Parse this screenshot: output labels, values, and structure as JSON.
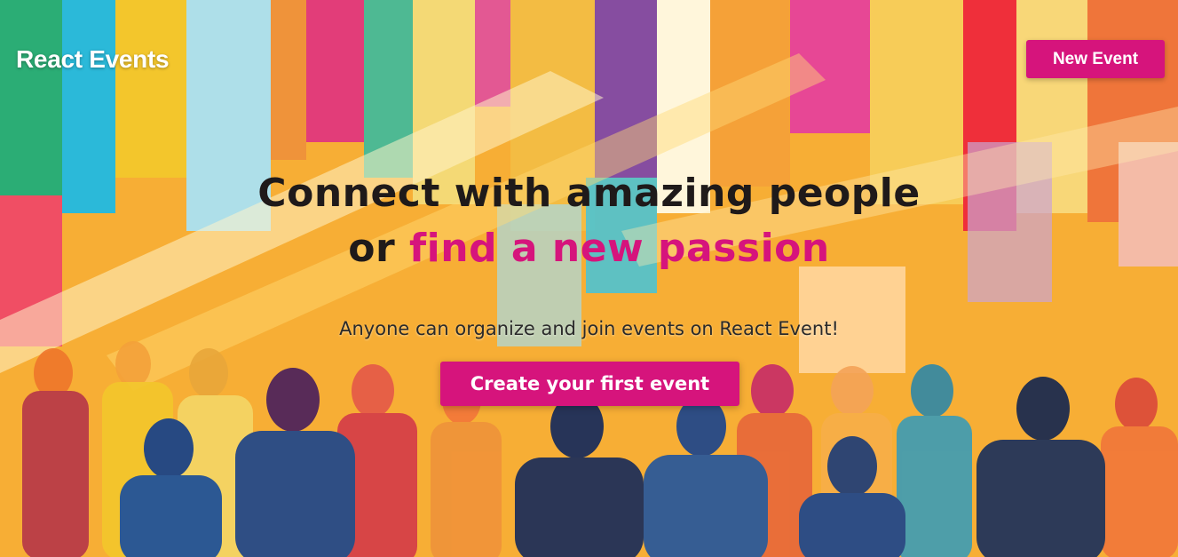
{
  "navbar": {
    "brand": "React Events",
    "new_event_label": "New Event"
  },
  "hero": {
    "headline_line1": "Connect with amazing people",
    "headline_line2_prefix": "or ",
    "headline_line2_accent": "find a new passion",
    "subtitle": "Anyone can organize and join events on React Event!",
    "cta_label": "Create your first event",
    "background_image": "colorful-crowd-illustration"
  },
  "colors": {
    "accent": "#d6147c",
    "headline": "#1f1a1a",
    "brand_text": "#ffffff"
  }
}
